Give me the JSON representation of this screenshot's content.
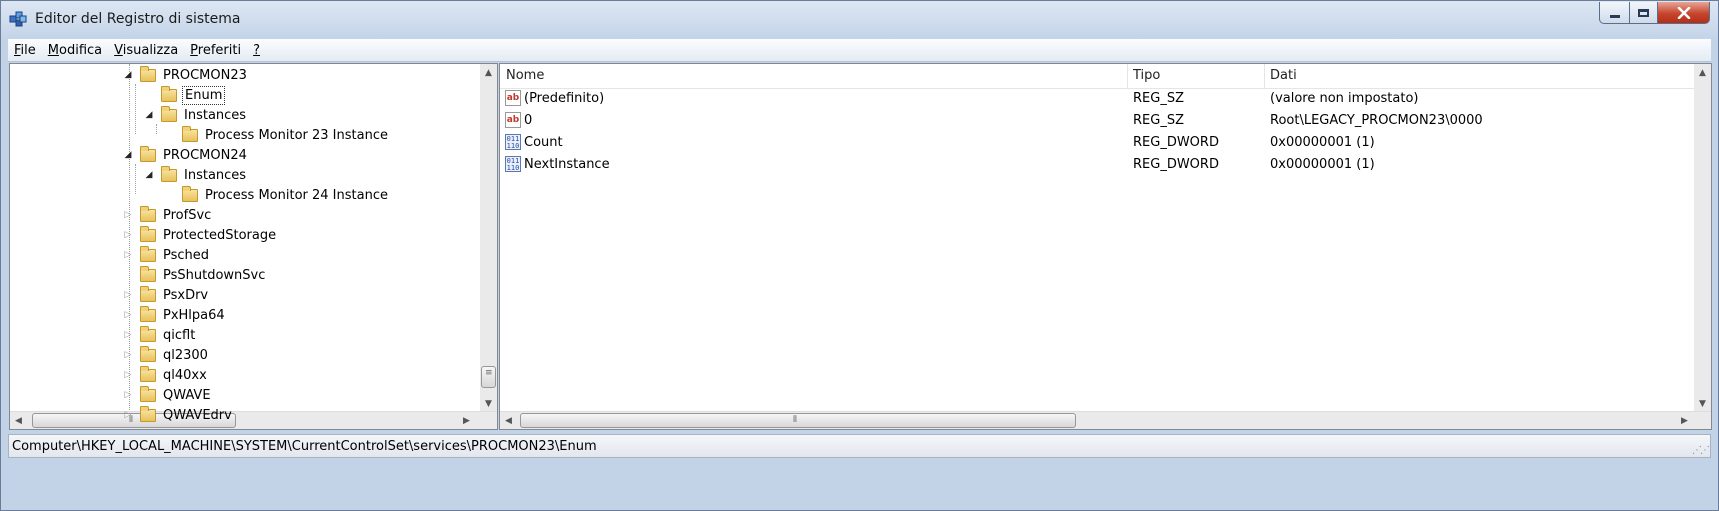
{
  "window": {
    "title": "Editor del Registro di sistema",
    "icon": "regedit-icon"
  },
  "menu": [
    "File",
    "Modifica",
    "Visualizza",
    "Preferiti",
    "?"
  ],
  "menu_accels": [
    "F",
    "M",
    "V",
    "P",
    "?"
  ],
  "tree": [
    {
      "label": "PROCMON23",
      "level": 0,
      "expander": "open"
    },
    {
      "label": "Enum",
      "level": 1,
      "expander": "none",
      "selected": true
    },
    {
      "label": "Instances",
      "level": 1,
      "expander": "open"
    },
    {
      "label": "Process Monitor 23 Instance",
      "level": 2,
      "expander": "none"
    },
    {
      "label": "PROCMON24",
      "level": 0,
      "expander": "open"
    },
    {
      "label": "Instances",
      "level": 1,
      "expander": "open"
    },
    {
      "label": "Process Monitor 24 Instance",
      "level": 2,
      "expander": "none"
    },
    {
      "label": "ProfSvc",
      "level": 0,
      "expander": "closed"
    },
    {
      "label": "ProtectedStorage",
      "level": 0,
      "expander": "closed"
    },
    {
      "label": "Psched",
      "level": 0,
      "expander": "closed"
    },
    {
      "label": "PsShutdownSvc",
      "level": 0,
      "expander": "none"
    },
    {
      "label": "PsxDrv",
      "level": 0,
      "expander": "closed"
    },
    {
      "label": "PxHlpa64",
      "level": 0,
      "expander": "closed"
    },
    {
      "label": "qicflt",
      "level": 0,
      "expander": "closed"
    },
    {
      "label": "ql2300",
      "level": 0,
      "expander": "closed"
    },
    {
      "label": "ql40xx",
      "level": 0,
      "expander": "closed"
    },
    {
      "label": "QWAVE",
      "level": 0,
      "expander": "closed"
    },
    {
      "label": "QWAVEdrv",
      "level": 0,
      "expander": "closed"
    }
  ],
  "columns": {
    "name": "Nome",
    "type": "Tipo",
    "data": "Dati"
  },
  "values": [
    {
      "name": "(Predefinito)",
      "type": "REG_SZ",
      "data": "(valore non impostato)",
      "icon": "string-value-icon"
    },
    {
      "name": "0",
      "type": "REG_SZ",
      "data": "Root\\LEGACY_PROCMON23\\0000",
      "icon": "string-value-icon"
    },
    {
      "name": "Count",
      "type": "REG_DWORD",
      "data": "0x00000001 (1)",
      "icon": "binary-value-icon"
    },
    {
      "name": "NextInstance",
      "type": "REG_DWORD",
      "data": "0x00000001 (1)",
      "icon": "binary-value-icon"
    }
  ],
  "status": {
    "path": "Computer\\HKEY_LOCAL_MACHINE\\SYSTEM\\CurrentControlSet\\services\\PROCMON23\\Enum"
  }
}
